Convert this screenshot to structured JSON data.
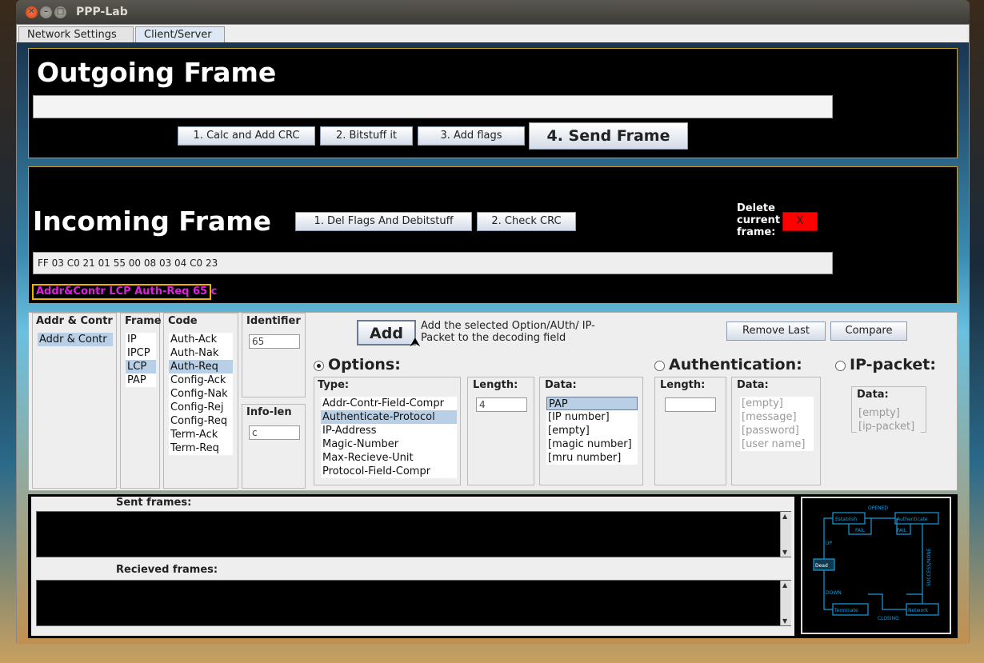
{
  "window": {
    "title": "PPP-Lab"
  },
  "tabs": [
    {
      "label": "Network Settings"
    },
    {
      "label": "Client/Server"
    }
  ],
  "outgoing": {
    "title": "Outgoing Frame",
    "frame_value": "",
    "buttons": {
      "calc_crc": "1. Calc and Add CRC",
      "bitstuff": "2. Bitstuff it",
      "flags": "3. Add flags",
      "send": "4. Send Frame"
    }
  },
  "incoming": {
    "title": "Incoming Frame",
    "buttons": {
      "del_flags": "1. Del Flags And Debitstuff",
      "check_crc": "2. Check CRC"
    },
    "delete_label": "Delete current frame:",
    "delete_button": "X",
    "frame_hex": "FF 03 C0 21 01 55 00 08 03 04 C0 23",
    "decoded": "Addr&Contr LCP Auth-Req 65 c"
  },
  "builder": {
    "addr_contr": {
      "label": "Addr & Contr",
      "items": [
        "Addr & Contr"
      ]
    },
    "frame": {
      "label": "Frame",
      "items": [
        "IP",
        "IPCP",
        "LCP",
        "PAP"
      ],
      "selected": "LCP"
    },
    "code": {
      "label": "Code",
      "items": [
        "Auth-Ack",
        "Auth-Nak",
        "Auth-Req",
        "Config-Ack",
        "Config-Nak",
        "Config-Rej",
        "Config-Req",
        "Term-Ack",
        "Term-Req"
      ],
      "selected": "Auth-Req"
    },
    "identifier": {
      "label": "Identifier",
      "value": "65"
    },
    "info_len": {
      "label": "Info-len",
      "value": "c"
    },
    "add_button": "Add",
    "add_desc": "Add the selected Option/AUth/ IP-Packet to the decoding field",
    "remove_last": "Remove Last",
    "compare": "Compare",
    "options": {
      "label": "Options:",
      "type_label": "Type:",
      "types": [
        "Addr-Contr-Field-Compr",
        "Authenticate-Protocol",
        "IP-Address",
        "Magic-Number",
        "Max-Recieve-Unit",
        "Protocol-Field-Compr"
      ],
      "type_selected": "Authenticate-Protocol",
      "length_label": "Length:",
      "length_value": "4",
      "data_label": "Data:",
      "data": [
        "PAP",
        "[IP number]",
        "[empty]",
        "[magic number]",
        "[mru number]"
      ],
      "data_selected": "PAP"
    },
    "authentication": {
      "label": "Authentication:",
      "length_label": "Length:",
      "length_value": "",
      "data_label": "Data:",
      "data": [
        "[empty]",
        "[message]",
        "[password]",
        "[user name]"
      ]
    },
    "ip_packet": {
      "label": "IP-packet:",
      "data_label": "Data:",
      "data": [
        "[empty]",
        "[ip-packet]"
      ]
    }
  },
  "log": {
    "sent_label": "Sent frames:",
    "received_label": "Recieved frames:"
  },
  "diagram": {
    "states": [
      "Establish",
      "Authenticate",
      "Dead",
      "Terminate",
      "Network"
    ],
    "transitions": [
      "OPENED",
      "FAIL",
      "FAIL",
      "UP",
      "SUCCESS/NONE",
      "DOWN",
      "CLOSING"
    ]
  },
  "colors": {
    "panel_black": "#000000",
    "border_gold": "#c8a020",
    "decoded_text": "#e020e0",
    "delete_red": "#ff0000",
    "diagram_blue": "#1a9ad8"
  }
}
